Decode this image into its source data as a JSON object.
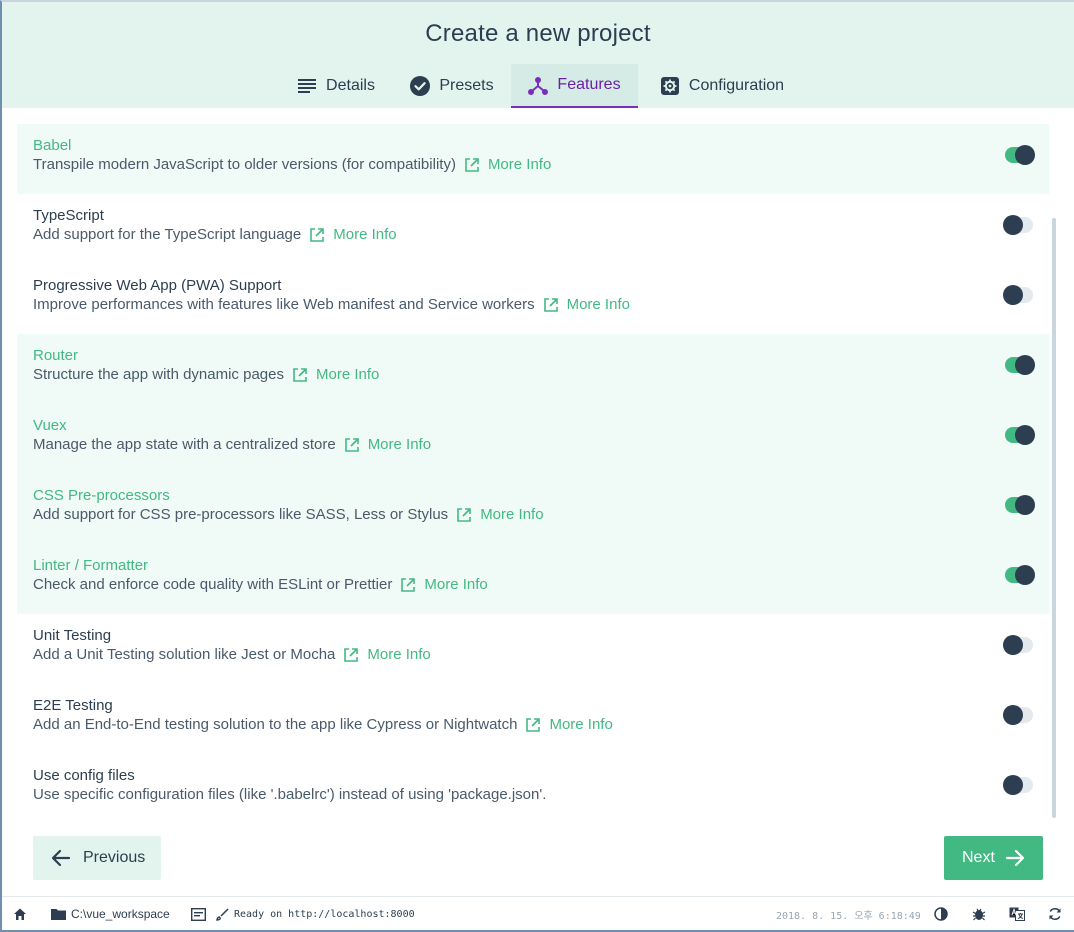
{
  "page": {
    "title": "Create a new project"
  },
  "tabs": [
    {
      "label": "Details",
      "icon": "list-icon",
      "active": false
    },
    {
      "label": "Presets",
      "icon": "check-circle-icon",
      "active": false
    },
    {
      "label": "Features",
      "icon": "fork-icon",
      "active": true
    },
    {
      "label": "Configuration",
      "icon": "gear-icon",
      "active": false
    }
  ],
  "features": [
    {
      "name": "Babel",
      "description": "Transpile modern JavaScript to older versions (for compatibility)",
      "more_info": "More Info",
      "enabled": true
    },
    {
      "name": "TypeScript",
      "description": "Add support for the TypeScript language",
      "more_info": "More Info",
      "enabled": false
    },
    {
      "name": "Progressive Web App (PWA) Support",
      "description": "Improve performances with features like Web manifest and Service workers",
      "more_info": "More Info",
      "enabled": false
    },
    {
      "name": "Router",
      "description": "Structure the app with dynamic pages",
      "more_info": "More Info",
      "enabled": true
    },
    {
      "name": "Vuex",
      "description": "Manage the app state with a centralized store",
      "more_info": "More Info",
      "enabled": true
    },
    {
      "name": "CSS Pre-processors",
      "description": "Add support for CSS pre-processors like SASS, Less or Stylus",
      "more_info": "More Info",
      "enabled": true
    },
    {
      "name": "Linter / Formatter",
      "description": "Check and enforce code quality with ESLint or Prettier",
      "more_info": "More Info",
      "enabled": true
    },
    {
      "name": "Unit Testing",
      "description": "Add a Unit Testing solution like Jest or Mocha",
      "more_info": "More Info",
      "enabled": false
    },
    {
      "name": "E2E Testing",
      "description": "Add an End-to-End testing solution to the app like Cypress or Nightwatch",
      "more_info": "More Info",
      "enabled": false
    },
    {
      "name": "Use config files",
      "description": "Use specific configuration files (like '.babelrc') instead of using 'package.json'.",
      "more_info": "",
      "enabled": false
    }
  ],
  "buttons": {
    "previous": "Previous",
    "next": "Next"
  },
  "statusbar": {
    "folder": "C:\\vue_workspace",
    "status": "Ready on http://localhost:8000",
    "timestamp": "2018. 8. 15. 오후 6:18:49"
  },
  "colors": {
    "accent": "#42b983",
    "active_tab": "#7b2cbf",
    "header_bg": "#e3f4ee",
    "text": "#2c3e50"
  }
}
